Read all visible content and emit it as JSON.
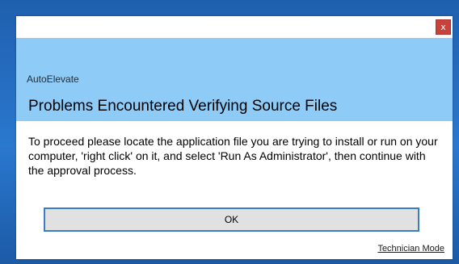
{
  "dialog": {
    "close_label": "x",
    "app_name": "AutoElevate",
    "heading": "Problems Encountered Verifying Source Files",
    "message": "To proceed please locate the application file you are trying to install or run on your computer, 'right click' on it, and select 'Run As Administrator', then continue with the approval process.",
    "ok_label": "OK",
    "technician_link": "Technician Mode"
  },
  "colors": {
    "banner": "#8ecbf6",
    "close_button": "#c9413b",
    "button_border": "#3a7cc6",
    "desktop": "#2a78cf"
  }
}
